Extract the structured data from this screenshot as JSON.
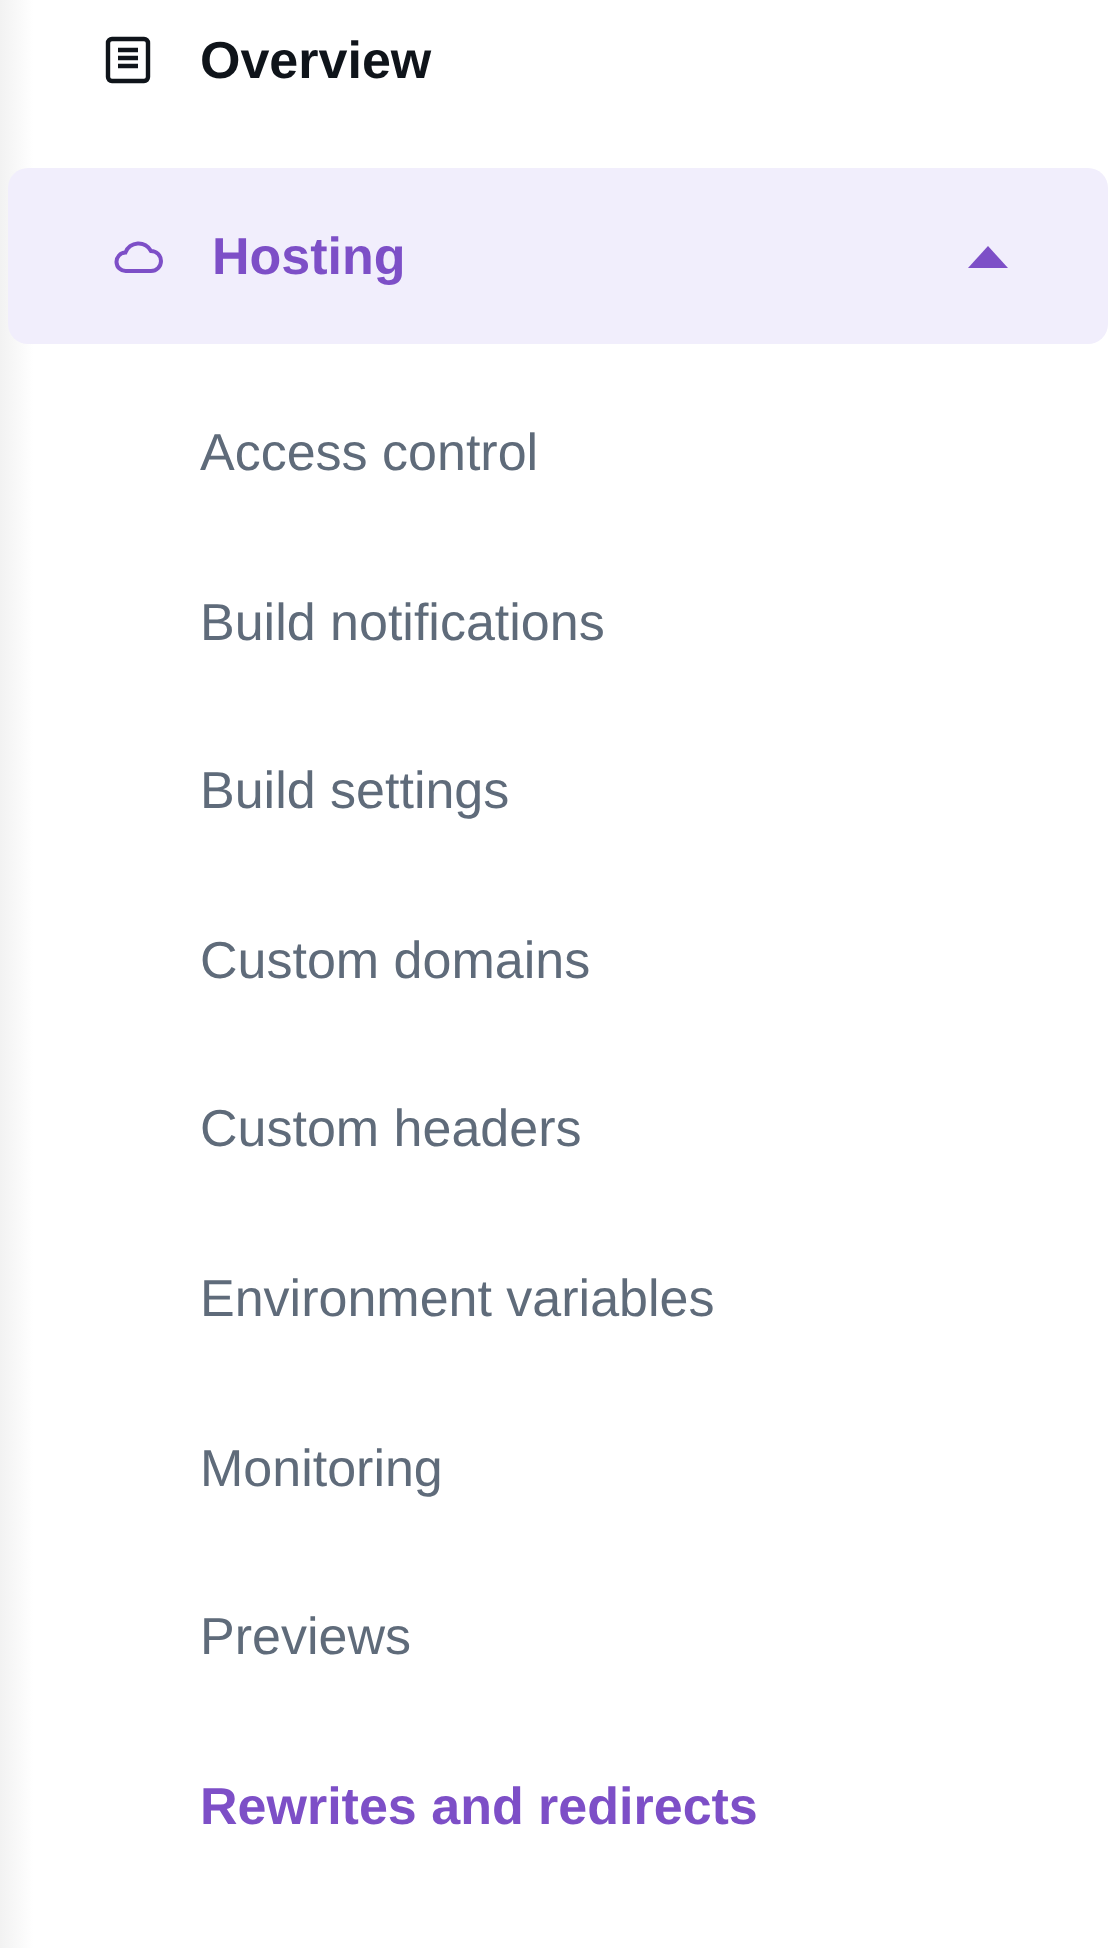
{
  "nav": [
    {
      "kind": "page",
      "label": "Overview",
      "selected": false
    },
    {
      "kind": "group",
      "label": "Hosting",
      "selected": true,
      "expanded": true,
      "children": [
        {
          "label": "Access control",
          "selected": false
        },
        {
          "label": "Build notifications",
          "selected": false
        },
        {
          "label": "Build settings",
          "selected": false
        },
        {
          "label": "Custom domains",
          "selected": false
        },
        {
          "label": "Custom headers",
          "selected": false
        },
        {
          "label": "Environment variables",
          "selected": false
        },
        {
          "label": "Monitoring",
          "selected": false
        },
        {
          "label": "Previews",
          "selected": false
        },
        {
          "label": "Rewrites and redirects",
          "selected": true
        }
      ]
    }
  ]
}
